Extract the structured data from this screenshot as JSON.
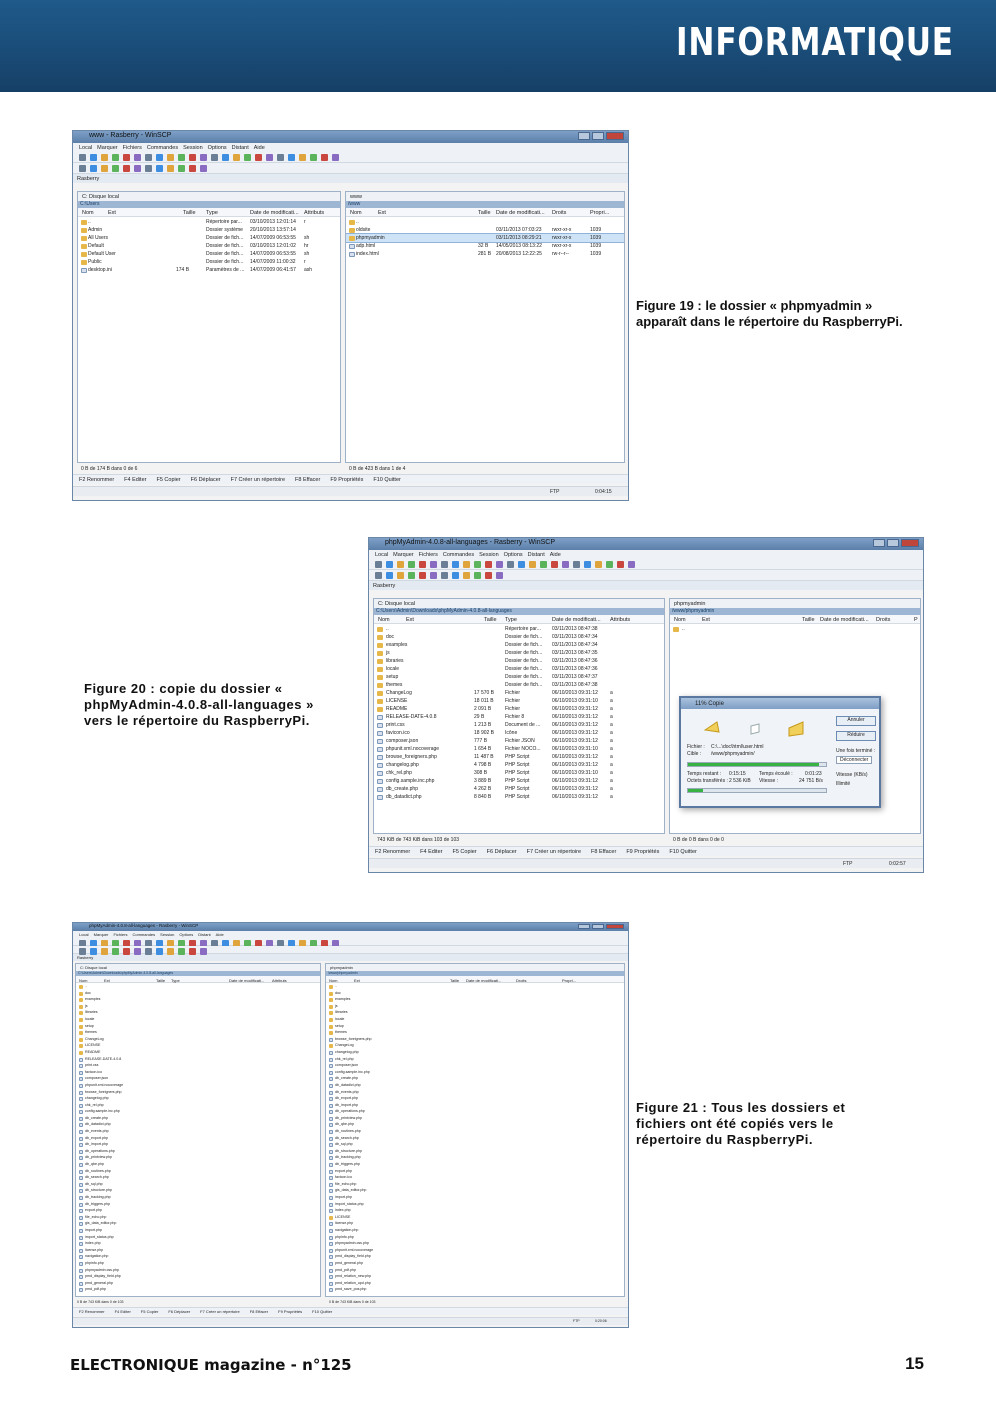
{
  "header": {
    "section_title": "INFORMATIQUE"
  },
  "figure19": {
    "window_title": "www - Rasberry - WinSCP",
    "menu": [
      "Local",
      "Marquer",
      "Fichiers",
      "Commandes",
      "Session",
      "Options",
      "Distant",
      "Aide"
    ],
    "session_tab": "Rasberry",
    "transfer_setting": "Défaut",
    "left_pane": {
      "address": "C: Disque local",
      "path": "C:\\Users",
      "columns": [
        "Nom",
        "Ext",
        "Taille",
        "Type",
        "Date de modificati...",
        "Attributs"
      ],
      "rows": [
        [
          "..",
          "",
          "",
          "Répertoire par...",
          "03/10/2013 12:01:14",
          "r"
        ],
        [
          "Admin",
          "",
          "",
          "Dossier système",
          "20/10/2013 13:57:14",
          ""
        ],
        [
          "All Users",
          "",
          "",
          "Dossier de fich...",
          "14/07/2009 06:53:55",
          "sh"
        ],
        [
          "Default",
          "",
          "",
          "Dossier de fich...",
          "03/10/2013 12:01:02",
          "hr"
        ],
        [
          "Default User",
          "",
          "",
          "Dossier de fich...",
          "14/07/2009 06:53:55",
          "sh"
        ],
        [
          "Public",
          "",
          "",
          "Dossier de fich...",
          "14/07/2009 11:00:32",
          "r"
        ],
        [
          "desktop.ini",
          "",
          "174 B",
          "Paramètres de ...",
          "14/07/2009 06:41:57",
          "ash"
        ]
      ],
      "status": "0 B de 174 B dans 0 de 6"
    },
    "right_pane": {
      "address": "www",
      "path": "/www",
      "columns": [
        "Nom",
        "Ext",
        "Taille",
        "Date de modificati...",
        "Droits",
        "Propri..."
      ],
      "rows": [
        [
          "..",
          "",
          "",
          "",
          "",
          ""
        ],
        [
          "oldsite",
          "",
          "",
          "03/11/2013 07:03:23",
          "rwxr-xr-x",
          "1039"
        ],
        [
          "phpmyadmin",
          "",
          "",
          "03/11/2013 08:29:21",
          "rwxr-xr-x",
          "1039"
        ],
        [
          "adp.html",
          "",
          "32 B",
          "14/05/2013 08:13:22",
          "rwxr-xr-x",
          "1039"
        ],
        [
          "index.html",
          "",
          "281 B",
          "20/08/2013 12:22:25",
          "rw-r--r--",
          "1039"
        ]
      ],
      "status": "0 B de 423 B dans 1 de 4"
    },
    "function_keys": [
      "F2 Renommer",
      "F4 Editer",
      "F5 Copier",
      "F6 Déplacer",
      "F7 Créer un répertoire",
      "F8 Effacer",
      "F9 Propriétés",
      "F10 Quitter"
    ],
    "bottom": {
      "protocol": "FTP",
      "time": "0:04:15"
    }
  },
  "caption19": "Figure 19 : le dossier « phpmyadmin » apparaît dans le répertoire du RaspberryPi.",
  "figure20": {
    "window_title": "phpMyAdmin-4.0.8-all-languages - Rasberry - WinSCP",
    "menu": [
      "Local",
      "Marquer",
      "Fichiers",
      "Commandes",
      "Session",
      "Options",
      "Distant",
      "Aide"
    ],
    "session_tab": "Rasberry",
    "transfer_setting": "Défaut",
    "left_pane": {
      "address": "C: Disque local",
      "path": "C:\\Users\\Admin\\Downloads\\phpMyAdmin-4.0.8-all-languages",
      "columns": [
        "Nom",
        "Ext",
        "Taille",
        "Type",
        "Date de modificati...",
        "Attributs"
      ],
      "rows": [
        [
          "..",
          "",
          "Répertoire par...",
          "03/11/2013 08:47:38",
          ""
        ],
        [
          "doc",
          "",
          "Dossier de fich...",
          "03/11/2013 08:47:34",
          ""
        ],
        [
          "examples",
          "",
          "Dossier de fich...",
          "03/11/2013 08:47:34",
          ""
        ],
        [
          "js",
          "",
          "Dossier de fich...",
          "03/11/2013 08:47:35",
          ""
        ],
        [
          "libraries",
          "",
          "Dossier de fich...",
          "03/11/2013 08:47:36",
          ""
        ],
        [
          "locale",
          "",
          "Dossier de fich...",
          "03/11/2013 08:47:36",
          ""
        ],
        [
          "setup",
          "",
          "Dossier de fich...",
          "03/11/2013 08:47:37",
          ""
        ],
        [
          "themes",
          "",
          "Dossier de fich...",
          "03/11/2013 08:47:38",
          ""
        ],
        [
          "ChangeLog",
          "17 570 B",
          "Fichier",
          "06/10/2013 09:31:12",
          "a"
        ],
        [
          "LICENSE",
          "18 011 B",
          "Fichier",
          "06/10/2013 09:31:10",
          "a"
        ],
        [
          "README",
          "2 091 B",
          "Fichier",
          "06/10/2013 09:31:12",
          "a"
        ],
        [
          "RELEASE-DATE-4.0.8",
          "29 B",
          "Fichier 8",
          "06/10/2013 09:31:12",
          "a"
        ],
        [
          "print.css",
          "1 213 B",
          "Document de ...",
          "06/10/2013 09:31:12",
          "a"
        ],
        [
          "favicon.ico",
          "18 902 B",
          "Icône",
          "06/10/2013 09:31:12",
          "a"
        ],
        [
          "composer.json",
          "777 B",
          "Fichier JSON",
          "06/10/2013 09:31:12",
          "a"
        ],
        [
          "phpunit.xml.nocoverage",
          "1 654 B",
          "Fichier NOCO...",
          "06/10/2013 09:31:10",
          "a"
        ],
        [
          "browse_foreigners.php",
          "11 487 B",
          "PHP Script",
          "06/10/2013 09:31:12",
          "a"
        ],
        [
          "changelog.php",
          "4 798 B",
          "PHP Script",
          "06/10/2013 09:31:12",
          "a"
        ],
        [
          "chk_rel.php",
          "308 B",
          "PHP Script",
          "06/10/2013 09:31:10",
          "a"
        ],
        [
          "config.sample.inc.php",
          "3 889 B",
          "PHP Script",
          "06/10/2013 09:31:12",
          "a"
        ],
        [
          "db_create.php",
          "4 262 B",
          "PHP Script",
          "06/10/2013 09:31:12",
          "a"
        ],
        [
          "db_datadict.php",
          "8 840 B",
          "PHP Script",
          "06/10/2013 09:31:12",
          "a"
        ]
      ],
      "status": "743 KiB de 743 KiB dans 103 de 103"
    },
    "right_pane": {
      "address": "phpmyadmin",
      "path": "/www/phpmyadmin",
      "columns": [
        "Nom",
        "Ext",
        "Taille",
        "Date de modificati...",
        "Droits",
        "P"
      ],
      "status": "0 B de 0 B dans 0 de 0"
    },
    "dialog": {
      "title": "11% Copie",
      "cancel": "Annuler",
      "reduce": "Réduire",
      "file_label": "Fichier :",
      "file_value": "C:\\...\\doc\\html\\user.html",
      "target_label": "Cible :",
      "target_value": "/www/phpmyadmin/",
      "when_done_label": "Une fois terminé :",
      "when_done_value": "Déconnecter",
      "remaining_label": "Temps restant :",
      "remaining_value": "0:15:15",
      "elapsed_label": "Temps écoulé :",
      "elapsed_value": "0:01:23",
      "bytes_label": "Octets transférés :",
      "bytes_value": "2 536 KiB",
      "speed_label": "Vitesse :",
      "speed_value": "24 751 B/s",
      "speed_limit_label": "Vitesse (KB/s)",
      "speed_limit_value": "Illimité",
      "progress_overall": 0.11,
      "progress_file": 0.95
    },
    "function_keys": [
      "F2 Renommer",
      "F4 Editer",
      "F5 Copier",
      "F6 Déplacer",
      "F7 Créer un répertoire",
      "F8 Effacer",
      "F9 Propriétés",
      "F10 Quitter"
    ],
    "bottom": {
      "protocol": "FTP",
      "time": "0:02:57"
    }
  },
  "caption20": "Figure 20 : copie du dossier « phpMyAdmin-4.0.8-all-languages » vers le répertoire du RaspberryPi.",
  "figure21": {
    "window_title": "phpMyAdmin-4.0.8-all-languages - Rasberry - WinSCP",
    "menu": [
      "Local",
      "Marquer",
      "Fichiers",
      "Commandes",
      "Session",
      "Options",
      "Distant",
      "Aide"
    ],
    "session_tab": "Rasberry",
    "transfer_setting": "Défaut",
    "left_pane": {
      "address": "C: Disque local",
      "path": "C:\\Users\\Admin\\Downloads\\phpMyAdmin-4.0.8-all-languages",
      "columns": [
        "Nom",
        "Ext",
        "Taille",
        "Type",
        "Date de modificati...",
        "Attributs"
      ],
      "files": [
        "..",
        "doc",
        "examples",
        "js",
        "libraries",
        "locale",
        "setup",
        "themes",
        "ChangeLog",
        "LICENSE",
        "README",
        "RELEASE-DATE-4.0.8",
        "print.css",
        "favicon.ico",
        "composer.json",
        "phpunit.xml.nocoverage",
        "browse_foreigners.php",
        "changelog.php",
        "chk_rel.php",
        "config.sample.inc.php",
        "db_create.php",
        "db_datadict.php",
        "db_events.php",
        "db_export.php",
        "db_import.php",
        "db_operations.php",
        "db_printview.php",
        "db_qbe.php",
        "db_routines.php",
        "db_search.php",
        "db_sql.php",
        "db_structure.php",
        "db_tracking.php",
        "db_triggers.php",
        "export.php",
        "file_echo.php",
        "gis_data_editor.php",
        "import.php",
        "import_status.php",
        "index.php",
        "license.php",
        "navigation.php",
        "phpinfo.php",
        "phpmyadmin.css.php",
        "pmd_display_field.php",
        "pmd_general.php",
        "pmd_pdf.php"
      ],
      "status": "0 B de 743 KiB dans 0 de 103"
    },
    "right_pane": {
      "address": "phpmyadmin",
      "path": "/www/phpmyadmin",
      "columns": [
        "Nom",
        "Ext",
        "Taille",
        "Date de modificati...",
        "Droits",
        "Propri..."
      ],
      "files": [
        "..",
        "doc",
        "examples",
        "js",
        "libraries",
        "locale",
        "setup",
        "themes",
        "browse_foreigners.php",
        "ChangeLog",
        "changelog.php",
        "chk_rel.php",
        "composer.json",
        "config.sample.inc.php",
        "db_create.php",
        "db_datadict.php",
        "db_events.php",
        "db_export.php",
        "db_import.php",
        "db_operations.php",
        "db_printview.php",
        "db_qbe.php",
        "db_routines.php",
        "db_search.php",
        "db_sql.php",
        "db_structure.php",
        "db_tracking.php",
        "db_triggers.php",
        "export.php",
        "favicon.ico",
        "file_echo.php",
        "gis_data_editor.php",
        "import.php",
        "import_status.php",
        "index.php",
        "LICENSE",
        "license.php",
        "navigation.php",
        "phpinfo.php",
        "phpmyadmin.css.php",
        "phpunit.xml.nocoverage",
        "pmd_display_field.php",
        "pmd_general.php",
        "pmd_pdf.php",
        "pmd_relation_new.php",
        "pmd_relation_upd.php",
        "pmd_save_pos.php"
      ],
      "status": "0 B de 743 KiB dans 0 de 103"
    },
    "function_keys": [
      "F2 Renommer",
      "F4 Editer",
      "F5 Copier",
      "F6 Déplacer",
      "F7 Créer un répertoire",
      "F8 Effacer",
      "F9 Propriétés",
      "F10 Quitter"
    ],
    "bottom": {
      "protocol": "FTP",
      "time": "0:20:06"
    }
  },
  "caption21": "Figure 21 : Tous les dossiers et fichiers ont été copiés vers le répertoire du RaspberryPi.",
  "footer": {
    "magazine": "ELECTRONIQUE magazine - n°125",
    "page": "15"
  },
  "colors": {
    "header_blue": "#1a4c78",
    "window_border": "#6a87a8",
    "selection": "#cfe3f7",
    "progress_green": "#38b243"
  }
}
